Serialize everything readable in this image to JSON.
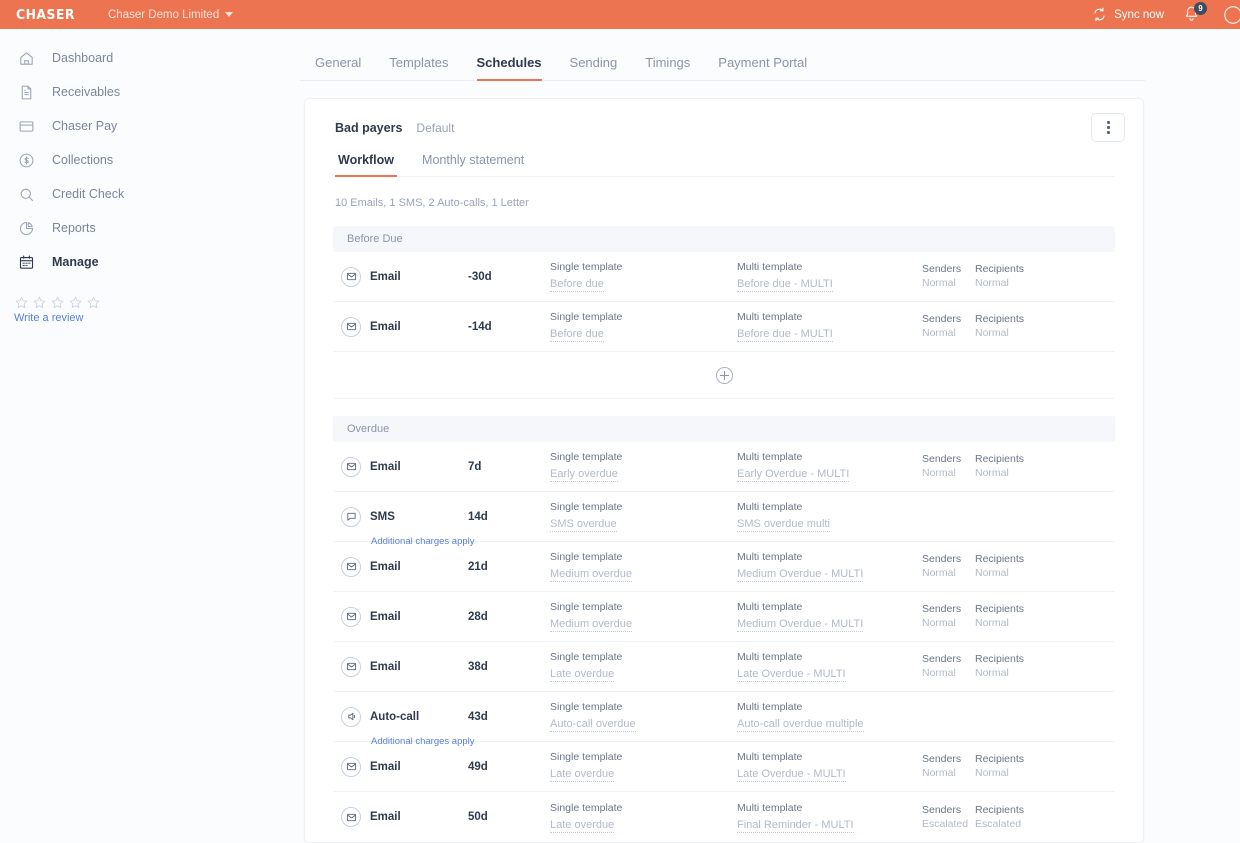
{
  "topbar": {
    "brand": "CHASER",
    "org": "Chaser Demo Limited",
    "sync_label": "Sync now",
    "notification_count": "9"
  },
  "sidebar": {
    "items": [
      {
        "label": "Dashboard",
        "icon": "home-icon",
        "active": false
      },
      {
        "label": "Receivables",
        "icon": "document-icon",
        "active": false
      },
      {
        "label": "Chaser Pay",
        "icon": "card-icon",
        "active": false
      },
      {
        "label": "Collections",
        "icon": "dollar-circle-icon",
        "active": false
      },
      {
        "label": "Credit Check",
        "icon": "search-icon",
        "active": false
      },
      {
        "label": "Reports",
        "icon": "pie-chart-icon",
        "active": false
      },
      {
        "label": "Manage",
        "icon": "calendar-icon",
        "active": true
      }
    ],
    "review_link": "Write a review",
    "star_count": 5
  },
  "tabs": [
    {
      "label": "General",
      "active": false
    },
    {
      "label": "Templates",
      "active": false
    },
    {
      "label": "Schedules",
      "active": true
    },
    {
      "label": "Sending",
      "active": false
    },
    {
      "label": "Timings",
      "active": false
    },
    {
      "label": "Payment Portal",
      "active": false
    }
  ],
  "card": {
    "title": "Bad payers",
    "subtitle": "Default",
    "subtabs": [
      {
        "label": "Workflow",
        "active": true
      },
      {
        "label": "Monthly statement",
        "active": false
      }
    ],
    "summary": "10 Emails, 1 SMS, 2 Auto-calls, 1 Letter",
    "menu_icon": "kebab-menu-icon",
    "add_icon": "plus-circle-icon"
  },
  "columns": {
    "single_template": "Single template",
    "multi_template": "Multi template",
    "senders": "Senders",
    "recipients": "Recipients"
  },
  "sections": [
    {
      "title": "Before Due",
      "has_add_row": true,
      "rows": [
        {
          "type": "Email",
          "icon": "email-icon",
          "days": "-30d",
          "single_label": "Single template",
          "single_value": "Before due",
          "multi_label": "Multi template",
          "multi_value": "Before due - MULTI",
          "senders_label": "Senders",
          "senders_value": "Normal",
          "recipients_label": "Recipients",
          "recipients_value": "Normal",
          "charges": ""
        },
        {
          "type": "Email",
          "icon": "email-icon",
          "days": "-14d",
          "single_label": "Single template",
          "single_value": "Before due",
          "multi_label": "Multi template",
          "multi_value": "Before due - MULTI",
          "senders_label": "Senders",
          "senders_value": "Normal",
          "recipients_label": "Recipients",
          "recipients_value": "Normal",
          "charges": ""
        }
      ]
    },
    {
      "title": "Overdue",
      "has_add_row": false,
      "rows": [
        {
          "type": "Email",
          "icon": "email-icon",
          "days": "7d",
          "single_label": "Single template",
          "single_value": "Early overdue",
          "multi_label": "Multi template",
          "multi_value": "Early Overdue - MULTI",
          "senders_label": "Senders",
          "senders_value": "Normal",
          "recipients_label": "Recipients",
          "recipients_value": "Normal",
          "charges": ""
        },
        {
          "type": "SMS",
          "icon": "sms-icon",
          "days": "14d",
          "single_label": "Single template",
          "single_value": "SMS overdue",
          "multi_label": "Multi template",
          "multi_value": "SMS overdue multi",
          "senders_label": "",
          "senders_value": "",
          "recipients_label": "",
          "recipients_value": "",
          "charges": "Additional charges apply"
        },
        {
          "type": "Email",
          "icon": "email-icon",
          "days": "21d",
          "single_label": "Single template",
          "single_value": "Medium overdue",
          "multi_label": "Multi template",
          "multi_value": "Medium Overdue - MULTI",
          "senders_label": "Senders",
          "senders_value": "Normal",
          "recipients_label": "Recipients",
          "recipients_value": "Normal",
          "charges": ""
        },
        {
          "type": "Email",
          "icon": "email-icon",
          "days": "28d",
          "single_label": "Single template",
          "single_value": "Medium overdue",
          "multi_label": "Multi template",
          "multi_value": "Medium Overdue - MULTI",
          "senders_label": "Senders",
          "senders_value": "Normal",
          "recipients_label": "Recipients",
          "recipients_value": "Normal",
          "charges": ""
        },
        {
          "type": "Email",
          "icon": "email-icon",
          "days": "38d",
          "single_label": "Single template",
          "single_value": "Late overdue",
          "multi_label": "Multi template",
          "multi_value": "Late Overdue - MULTI",
          "senders_label": "Senders",
          "senders_value": "Normal",
          "recipients_label": "Recipients",
          "recipients_value": "Normal",
          "charges": ""
        },
        {
          "type": "Auto-call",
          "icon": "speaker-icon",
          "days": "43d",
          "single_label": "Single template",
          "single_value": "Auto-call overdue",
          "multi_label": "Multi template",
          "multi_value": "Auto-call overdue multiple",
          "senders_label": "",
          "senders_value": "",
          "recipients_label": "",
          "recipients_value": "",
          "charges": "Additional charges apply"
        },
        {
          "type": "Email",
          "icon": "email-icon",
          "days": "49d",
          "single_label": "Single template",
          "single_value": "Late overdue",
          "multi_label": "Multi template",
          "multi_value": "Late Overdue - MULTI",
          "senders_label": "Senders",
          "senders_value": "Normal",
          "recipients_label": "Recipients",
          "recipients_value": "Normal",
          "charges": ""
        },
        {
          "type": "Email",
          "icon": "email-icon",
          "days": "50d",
          "single_label": "Single template",
          "single_value": "Late overdue",
          "multi_label": "Multi template",
          "multi_value": "Final Reminder - MULTI",
          "senders_label": "Senders",
          "senders_value": "Escalated",
          "recipients_label": "Recipients",
          "recipients_value": "Escalated",
          "charges": ""
        }
      ]
    }
  ],
  "colors": {
    "brand": "#ec7450",
    "accent": "#ec7450",
    "link": "#5b7fd4",
    "text_dark": "#2f3a4d",
    "text_muted": "#8b95aa"
  }
}
